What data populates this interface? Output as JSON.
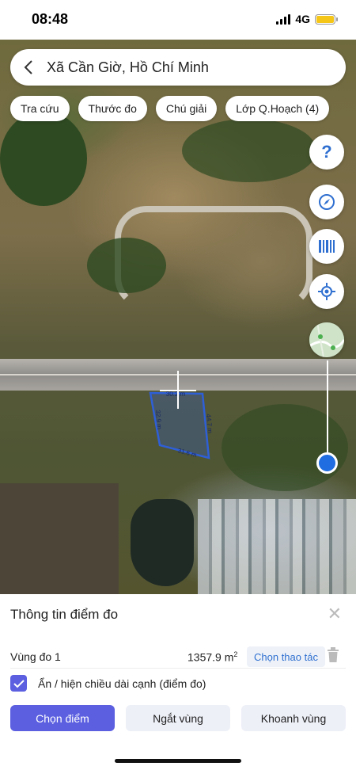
{
  "status_bar": {
    "time": "08:48",
    "network": "4G"
  },
  "search": {
    "location": "Xã Cần Giờ, Hồ Chí Minh"
  },
  "chips": [
    "Tra cứu",
    "Thước đo",
    "Chú giải",
    "Lớp Q.Hoạch (4)"
  ],
  "map": {
    "edge_labels": [
      "30.2 m",
      "32.9 m",
      "44.7 m",
      "31.6 m"
    ],
    "parcel_color": "#2f5fd6"
  },
  "tools": {
    "help": "?",
    "icons": [
      "help-icon",
      "compass-icon",
      "barcode-icon",
      "locate-icon",
      "map-layer-icon"
    ],
    "opacity_slider_level": 0.1
  },
  "panel": {
    "title": "Thông tin điểm đo",
    "area_label": "Vùng đo 1",
    "area_value": "1357.9 m",
    "area_unit_sup": "2",
    "action_label": "Chọn thao tác",
    "toggle_label": "Ẩn / hiện chiều dài cạnh (điểm đo)",
    "toggle_checked": true,
    "buttons": [
      "Chọn điểm",
      "Ngắt vùng",
      "Khoanh vùng"
    ]
  },
  "colors": {
    "accent": "#5b5fe0",
    "tool_blue": "#2f6fd0",
    "battery": "#f5c518"
  }
}
